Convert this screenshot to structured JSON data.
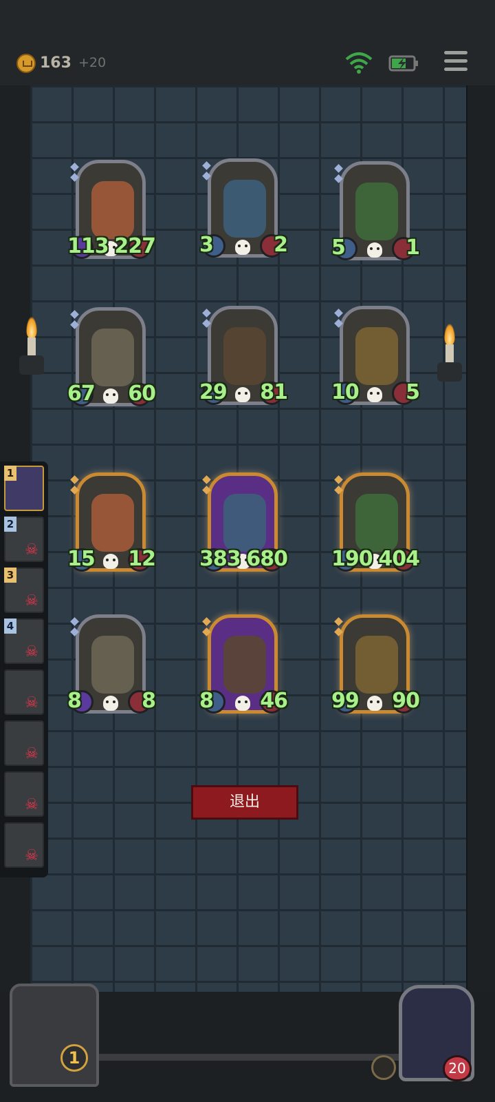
{
  "header": {
    "gold": "163",
    "gold_income": "+20",
    "icons": [
      "coin-icon",
      "wifi-icon",
      "battery-charging-icon",
      "menu-icon"
    ]
  },
  "opponent_board": [
    {
      "name": "red-robot",
      "attack": "113",
      "health": "227",
      "frame": "silver",
      "attack_type": "venom"
    },
    {
      "name": "puppet-boy",
      "attack": "3",
      "health": "2",
      "frame": "silver",
      "attack_type": "normal"
    },
    {
      "name": "beanstalk",
      "attack": "5",
      "health": "1",
      "frame": "silver",
      "attack_type": "normal"
    },
    {
      "name": "mech-knight",
      "attack": "67",
      "health": "60",
      "frame": "silver",
      "attack_type": "normal"
    },
    {
      "name": "evil-tree",
      "attack": "29",
      "health": "81",
      "frame": "silver",
      "attack_type": "normal"
    },
    {
      "name": "mechanical-dog",
      "attack": "10",
      "health": "5",
      "frame": "silver",
      "attack_type": "normal"
    }
  ],
  "player_board": [
    {
      "name": "beanstalk",
      "attack": "15",
      "health": "12",
      "frame": "gold",
      "attack_type": "normal"
    },
    {
      "name": "evil-tree",
      "attack": "383",
      "health": "680",
      "frame": "gold-purple",
      "attack_type": "normal"
    },
    {
      "name": "leaf-girl",
      "attack": "190",
      "health": "404",
      "frame": "gold",
      "attack_type": "normal"
    },
    {
      "name": "ghost-lantern",
      "attack": "8",
      "health": "8",
      "frame": "silver",
      "attack_type": "venom"
    },
    {
      "name": "elf-witch",
      "attack": "8",
      "health": "46",
      "frame": "gold-purple",
      "attack_type": "normal"
    },
    {
      "name": "evil-clown",
      "attack": "99",
      "health": "90",
      "frame": "gold",
      "attack_type": "normal"
    }
  ],
  "leaderboard": [
    {
      "rank": "1",
      "state": "active"
    },
    {
      "rank": "2",
      "state": "dead"
    },
    {
      "rank": "3",
      "state": "dead"
    },
    {
      "rank": "4",
      "state": "dead"
    },
    {
      "rank": "",
      "state": "dead"
    },
    {
      "rank": "",
      "state": "dead"
    },
    {
      "rank": "",
      "state": "dead"
    },
    {
      "rank": "",
      "state": "dead"
    }
  ],
  "exit_label": "退出",
  "chest_count": "1",
  "hero_health": "20"
}
